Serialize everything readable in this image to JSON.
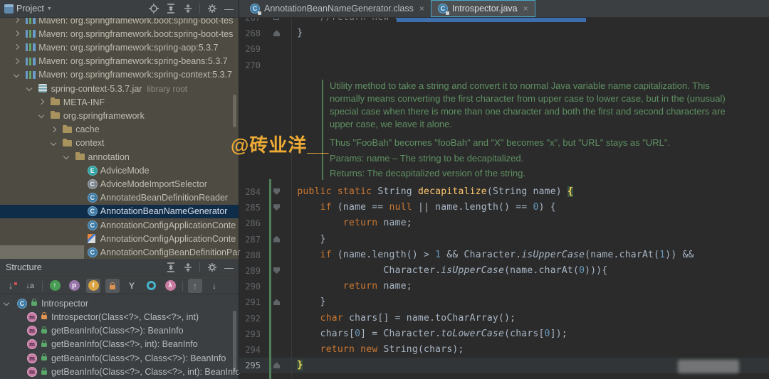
{
  "palette": {
    "bg_editor": "#2b2b2b",
    "bg_chrome": "#3c3f41",
    "bg_project": "#4e4b42",
    "sel": "#0f2c49",
    "kw": "#cc7832",
    "plain": "#a9b7c6",
    "num": "#6897bb",
    "method": "#ffc66d",
    "comment": "#7d7d7d",
    "doc": "#5f9163",
    "gutter": "#616569",
    "watermark": "#edaa35",
    "accent_tab": "#49a6c9",
    "green_bar": "#4f7f57",
    "caret_line": "#323537"
  },
  "watermark": "@砖业洋__",
  "project_panel": {
    "title": "Project",
    "header_icons": [
      {
        "name": "locate-icon",
        "type": "locate"
      },
      {
        "name": "expand-all-icon",
        "type": "expand"
      },
      {
        "name": "collapse-all-icon",
        "type": "collapse"
      },
      {
        "name": "divider",
        "type": "sep"
      },
      {
        "name": "settings-icon",
        "type": "gear"
      },
      {
        "name": "hide-icon",
        "type": "hide",
        "glyph": "—"
      }
    ],
    "tree": [
      {
        "label": "Maven: org.springframework.boot:spring-boot-tes",
        "chevron": ">",
        "icon": "lib",
        "indent": 1
      },
      {
        "label": "Maven: org.springframework.boot:spring-boot-tes",
        "chevron": ">",
        "icon": "lib",
        "indent": 1
      },
      {
        "label": "Maven: org.springframework:spring-aop:5.3.7",
        "chevron": ">",
        "icon": "lib",
        "indent": 1
      },
      {
        "label": "Maven: org.springframework:spring-beans:5.3.7",
        "chevron": ">",
        "icon": "lib",
        "indent": 1
      },
      {
        "label": "Maven: org.springframework:spring-context:5.3.7",
        "chevron": "v",
        "icon": "lib",
        "indent": 1
      },
      {
        "label": "spring-context-5.3.7.jar",
        "suffix": "library root",
        "chevron": "v",
        "icon": "jar",
        "indent": 2
      },
      {
        "label": "META-INF",
        "chevron": ">",
        "icon": "folder",
        "indent": 3
      },
      {
        "label": "org.springframework",
        "chevron": "v",
        "icon": "folder",
        "indent": 3
      },
      {
        "label": "cache",
        "chevron": ">",
        "icon": "folder",
        "indent": 4
      },
      {
        "label": "context",
        "chevron": "v",
        "icon": "folder",
        "indent": 4
      },
      {
        "label": "annotation",
        "chevron": "v",
        "icon": "folder",
        "indent": 5
      },
      {
        "label": "AdviceMode",
        "icon": "enum",
        "indent": 6
      },
      {
        "label": "AdviceModeImportSelector",
        "icon": "classdim",
        "indent": 6
      },
      {
        "label": "AnnotatedBeanDefinitionReader",
        "icon": "class",
        "indent": 6
      },
      {
        "label": "AnnotationBeanNameGenerator",
        "icon": "class",
        "indent": 6,
        "selected": true
      },
      {
        "label": "AnnotationConfigApplicationConte",
        "icon": "class",
        "indent": 6
      },
      {
        "label": "AnnotationConfigApplicationConte",
        "icon": "kotlin",
        "indent": 6
      },
      {
        "label": "AnnotationConfigBeanDefinitionPar",
        "icon": "class",
        "indent": 6,
        "band": true
      }
    ]
  },
  "structure_panel": {
    "title": "Structure",
    "header_icons": [
      {
        "name": "expand-all-icon",
        "type": "expand"
      },
      {
        "name": "collapse-all-icon",
        "type": "collapse"
      },
      {
        "name": "divider",
        "type": "sep"
      },
      {
        "name": "settings-icon",
        "type": "gear"
      },
      {
        "name": "hide-icon",
        "type": "hide",
        "glyph": "—"
      }
    ],
    "toolbar": [
      {
        "name": "sort-by-visibility",
        "type": "sort-vis"
      },
      {
        "name": "sort-alphabetically",
        "type": "sort-alpha"
      },
      {
        "name": "divider",
        "type": "sep"
      },
      {
        "name": "show-inherited",
        "type": "circle",
        "glyph": "↑",
        "color": "#499C54"
      },
      {
        "name": "show-properties",
        "type": "circle",
        "glyph": "p",
        "color": "#9876AA"
      },
      {
        "name": "show-fields",
        "type": "circle",
        "glyph": "f",
        "color": "#D9A343",
        "active": true
      },
      {
        "name": "show-non-public",
        "type": "lock",
        "color": "#E09453",
        "active": true
      },
      {
        "name": "group-methods",
        "type": "glyph",
        "glyph": "Y"
      },
      {
        "name": "show-visibility",
        "type": "donut",
        "color": "#45B3C9"
      },
      {
        "name": "show-lambdas",
        "type": "circle",
        "glyph": "λ",
        "color": "#C77BA2"
      },
      {
        "name": "divider",
        "type": "sep"
      },
      {
        "name": "scroll-to-source",
        "type": "boxarrow",
        "glyph": "↑",
        "active": true
      },
      {
        "name": "scroll-from-source",
        "type": "boxarrow",
        "glyph": "↓"
      }
    ],
    "tree": [
      {
        "label": "Introspector",
        "icon": "class",
        "chevron": "v",
        "lock": "green",
        "indent": 0
      },
      {
        "label": "Introspector(Class<?>, Class<?>, int)",
        "icon": "method",
        "lock": "orange",
        "indent": 1
      },
      {
        "label": "getBeanInfo(Class<?>): BeanInfo",
        "icon": "method",
        "lock": "green",
        "indent": 1
      },
      {
        "label": "getBeanInfo(Class<?>, int): BeanInfo",
        "icon": "method",
        "lock": "green",
        "indent": 1
      },
      {
        "label": "getBeanInfo(Class<?>, Class<?>): BeanInfo",
        "icon": "method",
        "lock": "green",
        "indent": 1
      },
      {
        "label": "getBeanInfo(Class<?>, Class<?>, int): BeanInfo",
        "icon": "method",
        "lock": "green",
        "indent": 1
      }
    ]
  },
  "editor": {
    "tabs": [
      {
        "label": "AnnotationBeanNameGenerator.class",
        "close": "×",
        "active": false
      },
      {
        "label": "Introspector.java",
        "close": "×",
        "active": true
      }
    ],
    "doc": {
      "para": [
        "Utility method to take a string and convert it to normal Java variable name capitalization. This",
        "normally means converting the first character from upper case to lower case, but in the (unusual)",
        "special case when there is more than one character and both the first and second characters are",
        "upper case, we leave it alone."
      ],
      "thus": "Thus \"FooBah\" becomes \"fooBah\" and \"X\" becomes \"x\", but \"URL\" stays as \"URL\".",
      "params_label": "Params:",
      "params_text": "name – The string to be decapitalized.",
      "returns_label": "Returns:",
      "returns_text": "The decapitalized version of the string."
    },
    "lines": [
      {
        "num": "267",
        "fold": "box",
        "segs": [
          [
            "cm",
            "        //return new GenericBeanInfo(bi);"
          ]
        ]
      },
      {
        "num": "268",
        "fold": "up",
        "segs": [
          [
            "pl",
            "    }"
          ]
        ]
      },
      {
        "num": "269",
        "segs": []
      },
      {
        "num": "270",
        "segs": []
      },
      {
        "num": "284",
        "fold": "down",
        "segs": [
          [
            "pl",
            "    "
          ],
          [
            "kw",
            "public"
          ],
          [
            "pl",
            " "
          ],
          [
            "kw",
            "static"
          ],
          [
            "pl",
            " String "
          ],
          [
            "me",
            "decapitalize"
          ],
          [
            "pl",
            "(String name) "
          ],
          [
            "brace",
            "{"
          ]
        ]
      },
      {
        "num": "285",
        "fold": "down",
        "segs": [
          [
            "pl",
            "        "
          ],
          [
            "kw",
            "if"
          ],
          [
            "pl",
            " (name == "
          ],
          [
            "kw",
            "null"
          ],
          [
            "pl",
            " || name.length() == "
          ],
          [
            "num",
            "0"
          ],
          [
            "pl",
            ") {"
          ]
        ]
      },
      {
        "num": "286",
        "segs": [
          [
            "pl",
            "            "
          ],
          [
            "kw",
            "return"
          ],
          [
            "pl",
            " name;"
          ]
        ]
      },
      {
        "num": "287",
        "fold": "up",
        "segs": [
          [
            "pl",
            "        }"
          ]
        ]
      },
      {
        "num": "288",
        "segs": [
          [
            "pl",
            "        "
          ],
          [
            "kw",
            "if"
          ],
          [
            "pl",
            " (name.length() > "
          ],
          [
            "num",
            "1"
          ],
          [
            "pl",
            " && Character."
          ],
          [
            "sm",
            "isUpperCase"
          ],
          [
            "pl",
            "(name.charAt("
          ],
          [
            "num",
            "1"
          ],
          [
            "pl",
            ")) &&"
          ]
        ]
      },
      {
        "num": "289",
        "fold": "down",
        "segs": [
          [
            "pl",
            "                   Character."
          ],
          [
            "sm",
            "isUpperCase"
          ],
          [
            "pl",
            "(name.charAt("
          ],
          [
            "num",
            "0"
          ],
          [
            "pl",
            ")))"
          ],
          [
            "pl",
            "{"
          ]
        ]
      },
      {
        "num": "290",
        "segs": [
          [
            "pl",
            "            "
          ],
          [
            "kw",
            "return"
          ],
          [
            "pl",
            " name;"
          ]
        ]
      },
      {
        "num": "291",
        "fold": "up",
        "segs": [
          [
            "pl",
            "        }"
          ]
        ]
      },
      {
        "num": "292",
        "segs": [
          [
            "pl",
            "        "
          ],
          [
            "kw",
            "char"
          ],
          [
            "pl",
            " chars[] = name.toCharArray();"
          ]
        ]
      },
      {
        "num": "293",
        "segs": [
          [
            "pl",
            "        chars["
          ],
          [
            "num",
            "0"
          ],
          [
            "pl",
            "] = Character."
          ],
          [
            "sm",
            "toLowerCase"
          ],
          [
            "pl",
            "(chars["
          ],
          [
            "num",
            "0"
          ],
          [
            "pl",
            "]);"
          ]
        ]
      },
      {
        "num": "294",
        "segs": [
          [
            "pl",
            "        "
          ],
          [
            "kw",
            "return"
          ],
          [
            "pl",
            " "
          ],
          [
            "kw",
            "new"
          ],
          [
            "pl",
            " String(chars);"
          ]
        ]
      },
      {
        "num": "295",
        "fold": "up",
        "cur": true,
        "segs": [
          [
            "pl",
            "    "
          ],
          [
            "brace",
            "}"
          ]
        ]
      }
    ]
  }
}
